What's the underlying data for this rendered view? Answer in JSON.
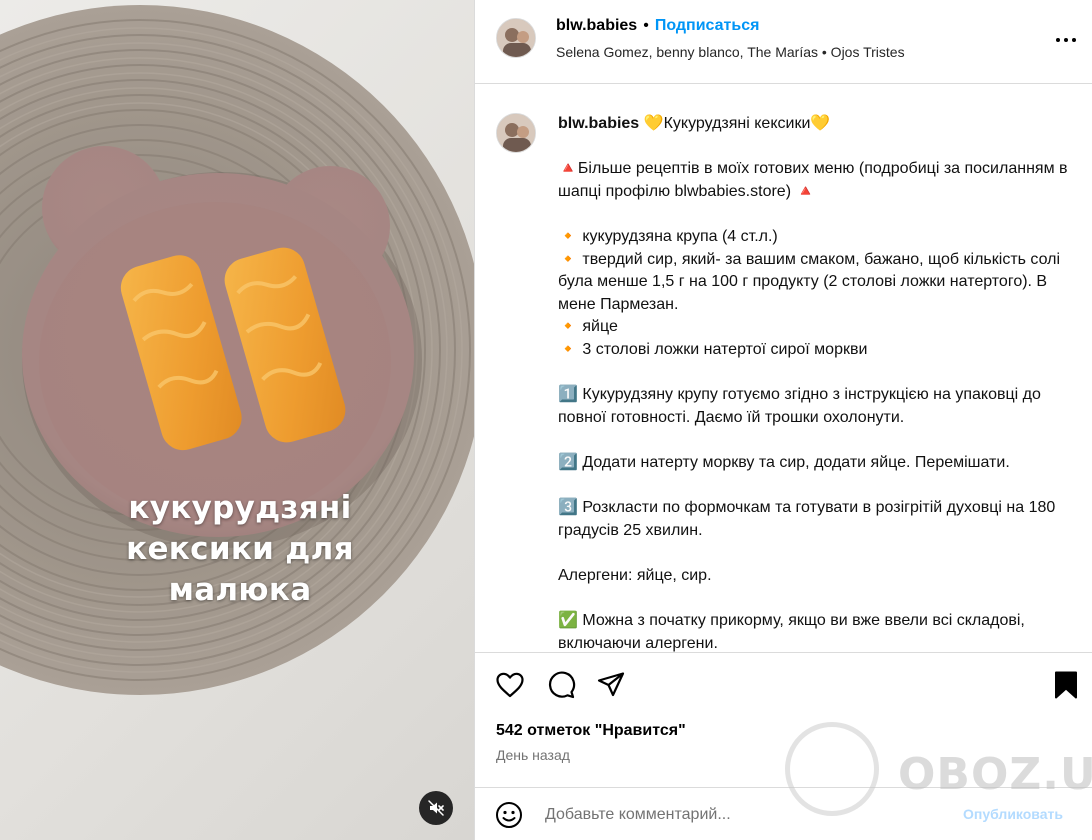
{
  "media": {
    "overlay_lines": [
      "кукурудзяні",
      "кексики для",
      "малюка"
    ],
    "mute_icon": "speaker-muted-icon"
  },
  "header": {
    "username": "blw.babies",
    "separator": "•",
    "follow_label": "Подписаться",
    "audio": "Selena Gomez, benny blanco, The Marías • Ojos Tristes",
    "more_icon": "more-options-icon"
  },
  "caption": {
    "username": "blw.babies",
    "title": " 💛Кукурудзяні кексики💛",
    "paragraphs": [
      [
        "🔺Більше рецептів в моїх готових меню (подробиці за посиланням в шапці профілю blwbabies.store) 🔺"
      ],
      [
        "🔸 кукурудзяна крупа (4 ст.л.)",
        "🔸 твердий сир, який- за вашим смаком, бажано, щоб кількість солі була менше 1,5 г на 100 г продукту (2 столові ложки натертого). В мене Пармезан.",
        "🔸 яйце",
        "🔸 3 столові ложки натертої сирої моркви"
      ],
      [
        "1️⃣ Кукурудзяну крупу готуємо згідно з інструкцією на упаковці до повної готовності. Даємо їй трошки охолонути."
      ],
      [
        "2️⃣ Додати натерту моркву та сир, додати яйце. Перемішати."
      ],
      [
        "3️⃣ Розкласти по формочкам та готувати в розігрітій духовці на 180 градусів 25 хвилин."
      ],
      [
        "Алергени: яйце, сир."
      ],
      [
        "✅ Можна з початку прикорму, якщо ви вже ввели всі складові, включаючи алергени."
      ]
    ]
  },
  "actions": {
    "likes": "542 отметок \"Нравится\"",
    "time_ago": "День назад",
    "comment_placeholder": "Добавьте комментарий...",
    "publish_label": "Опубликовать"
  },
  "watermark": {
    "text": "OBOZ.UA"
  },
  "colors": {
    "accent": "#0095f6",
    "plate": "#a98a86",
    "mat": "#9f9589",
    "muffin": "#f0a43a"
  }
}
